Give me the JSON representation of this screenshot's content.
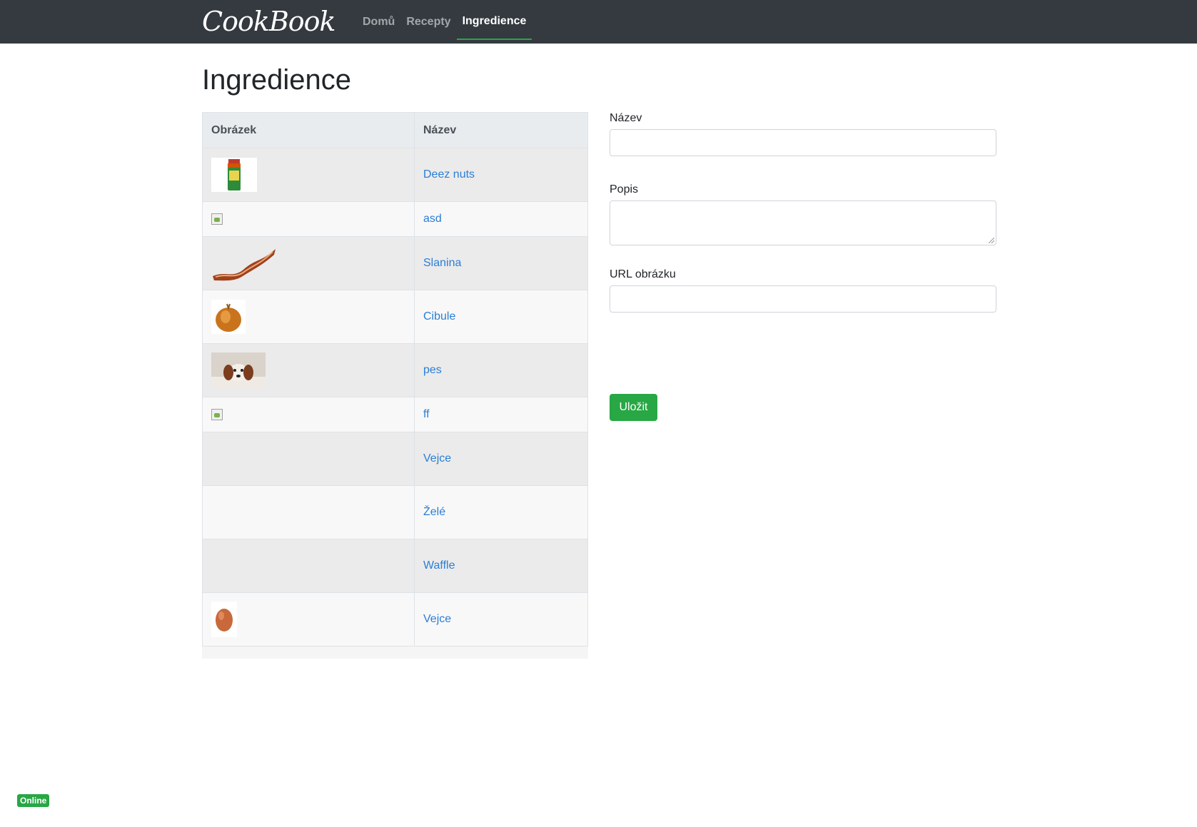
{
  "navbar": {
    "brand": "CookBook",
    "items": [
      {
        "label": "Domů",
        "active": false
      },
      {
        "label": "Recepty",
        "active": false
      },
      {
        "label": "Ingredience",
        "active": true
      }
    ]
  },
  "page": {
    "title": "Ingredience"
  },
  "table": {
    "headers": [
      "Obrázek",
      "Název"
    ],
    "rows": [
      {
        "name": "Deez nuts",
        "image": "spice-jar-icon"
      },
      {
        "name": "asd",
        "image": "broken-image-icon"
      },
      {
        "name": "Slanina",
        "image": "bacon-icon"
      },
      {
        "name": "Cibule",
        "image": "onion-icon"
      },
      {
        "name": "pes",
        "image": "dog-photo-icon"
      },
      {
        "name": "ff",
        "image": "broken-image-icon"
      },
      {
        "name": "Vejce",
        "image": ""
      },
      {
        "name": "Želé",
        "image": ""
      },
      {
        "name": "Waffle",
        "image": ""
      },
      {
        "name": "Vejce",
        "image": "egg-icon"
      }
    ]
  },
  "form": {
    "name_label": "Název",
    "name_value": "",
    "description_label": "Popis",
    "description_value": "",
    "image_url_label": "URL obrázku",
    "image_url_value": "",
    "save_label": "Uložit"
  },
  "status": {
    "label": "Online"
  },
  "colors": {
    "navbar": "#343a40",
    "accent": "#28a745",
    "link": "#2a7ed6"
  }
}
